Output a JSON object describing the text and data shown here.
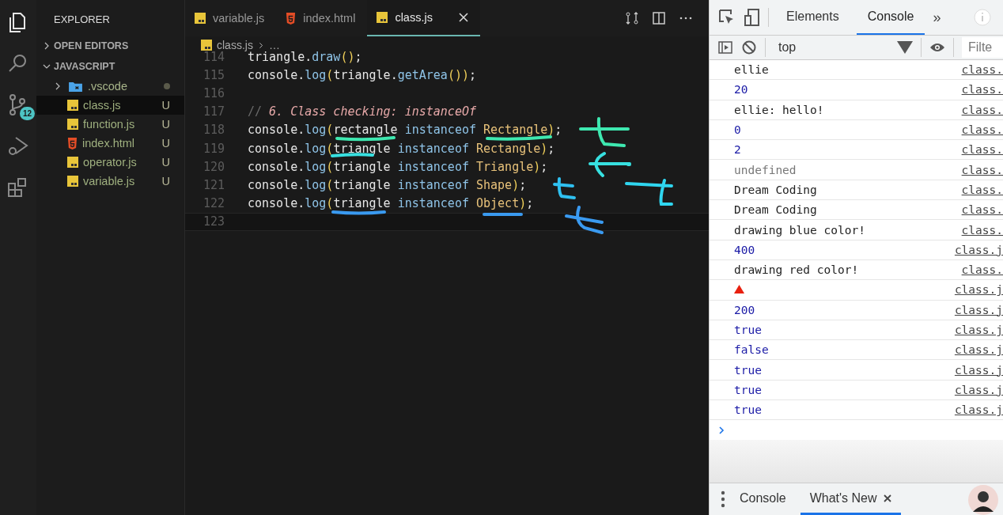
{
  "activity_bar": {
    "items": [
      {
        "kind": "files",
        "selected": true
      },
      {
        "kind": "search",
        "selected": false
      },
      {
        "kind": "source-control",
        "selected": false,
        "badge": "12"
      },
      {
        "kind": "run",
        "selected": false
      },
      {
        "kind": "extensions",
        "selected": false
      }
    ]
  },
  "sidebar": {
    "title": "EXPLORER",
    "sections": [
      {
        "label": "OPEN EDITORS",
        "expanded": false
      },
      {
        "label": "JAVASCRIPT",
        "expanded": true,
        "children": [
          {
            "name": ".vscode",
            "kind": "folder",
            "expanded": false,
            "selected": false
          },
          {
            "name": "class.js",
            "kind": "js",
            "status": "U",
            "selected": true
          },
          {
            "name": "function.js",
            "kind": "js",
            "status": "U",
            "selected": false
          },
          {
            "name": "index.html",
            "kind": "html",
            "status": "U",
            "selected": false
          },
          {
            "name": "operator.js",
            "kind": "js",
            "status": "U",
            "selected": false
          },
          {
            "name": "variable.js",
            "kind": "js",
            "status": "U",
            "selected": false
          }
        ]
      }
    ]
  },
  "editor": {
    "tabs": [
      {
        "label": "variable.js",
        "kind": "js",
        "selected": false
      },
      {
        "label": "index.html",
        "kind": "html",
        "selected": false
      },
      {
        "label": "class.js",
        "kind": "js",
        "selected": true
      }
    ],
    "breadcrumb": {
      "file": "class.js",
      "more": "…"
    },
    "lines": [
      {
        "number": "114",
        "current": false,
        "tokens": [
          {
            "kind": "plain",
            "text": "triangle"
          },
          {
            "kind": "punct",
            "text": "."
          },
          {
            "kind": "method",
            "text": "draw"
          },
          {
            "kind": "paren",
            "text": "()"
          },
          {
            "kind": "plain",
            "text": ";"
          }
        ]
      },
      {
        "number": "115",
        "current": false,
        "tokens": [
          {
            "kind": "plain",
            "text": "console"
          },
          {
            "kind": "punct",
            "text": "."
          },
          {
            "kind": "method",
            "text": "log"
          },
          {
            "kind": "paren",
            "text": "("
          },
          {
            "kind": "plain",
            "text": "triangle"
          },
          {
            "kind": "punct",
            "text": "."
          },
          {
            "kind": "method",
            "text": "getArea"
          },
          {
            "kind": "paren",
            "text": "())"
          },
          {
            "kind": "plain",
            "text": ";"
          }
        ]
      },
      {
        "number": "116",
        "current": false
      },
      {
        "number": "117",
        "current": false,
        "tokens": [
          {
            "kind": "comment-mark",
            "text": "// "
          },
          {
            "kind": "comment",
            "text": "6. Class checking: instanceOf"
          }
        ]
      },
      {
        "number": "118",
        "current": false,
        "tokens": [
          {
            "kind": "plain",
            "text": "console"
          },
          {
            "kind": "punct",
            "text": "."
          },
          {
            "kind": "method",
            "text": "log"
          },
          {
            "kind": "paren",
            "text": "("
          },
          {
            "kind": "plain",
            "text": "rectangle "
          },
          {
            "kind": "keyword",
            "text": "instanceof "
          },
          {
            "kind": "class",
            "text": "Rectangle"
          },
          {
            "kind": "paren",
            "text": ")"
          },
          {
            "kind": "plain",
            "text": ";"
          }
        ]
      },
      {
        "number": "119",
        "current": false,
        "tokens": [
          {
            "kind": "plain",
            "text": "console"
          },
          {
            "kind": "punct",
            "text": "."
          },
          {
            "kind": "method",
            "text": "log"
          },
          {
            "kind": "paren",
            "text": "("
          },
          {
            "kind": "plain",
            "text": "triangle "
          },
          {
            "kind": "keyword",
            "text": "instanceof "
          },
          {
            "kind": "class",
            "text": "Rectangle"
          },
          {
            "kind": "paren",
            "text": ")"
          },
          {
            "kind": "plain",
            "text": ";"
          }
        ]
      },
      {
        "number": "120",
        "current": false,
        "tokens": [
          {
            "kind": "plain",
            "text": "console"
          },
          {
            "kind": "punct",
            "text": "."
          },
          {
            "kind": "method",
            "text": "log"
          },
          {
            "kind": "paren",
            "text": "("
          },
          {
            "kind": "plain",
            "text": "triangle "
          },
          {
            "kind": "keyword",
            "text": "instanceof "
          },
          {
            "kind": "class",
            "text": "Triangle"
          },
          {
            "kind": "paren",
            "text": ")"
          },
          {
            "kind": "plain",
            "text": ";"
          }
        ]
      },
      {
        "number": "121",
        "current": false,
        "tokens": [
          {
            "kind": "plain",
            "text": "console"
          },
          {
            "kind": "punct",
            "text": "."
          },
          {
            "kind": "method",
            "text": "log"
          },
          {
            "kind": "paren",
            "text": "("
          },
          {
            "kind": "plain",
            "text": "triangle "
          },
          {
            "kind": "keyword",
            "text": "instanceof "
          },
          {
            "kind": "class",
            "text": "Shape"
          },
          {
            "kind": "paren",
            "text": ")"
          },
          {
            "kind": "plain",
            "text": ";"
          }
        ]
      },
      {
        "number": "122",
        "current": false,
        "tokens": [
          {
            "kind": "plain",
            "text": "console"
          },
          {
            "kind": "punct",
            "text": "."
          },
          {
            "kind": "method",
            "text": "log"
          },
          {
            "kind": "paren",
            "text": "("
          },
          {
            "kind": "plain",
            "text": "triangle "
          },
          {
            "kind": "keyword",
            "text": "instanceof "
          },
          {
            "kind": "class",
            "text": "Object"
          },
          {
            "kind": "paren",
            "text": ")"
          },
          {
            "kind": "plain",
            "text": ";"
          }
        ]
      },
      {
        "number": "123",
        "current": true
      }
    ]
  },
  "devtools": {
    "tabs": [
      {
        "label": "Elements",
        "selected": false
      },
      {
        "label": "Console",
        "selected": true
      }
    ],
    "more": "»",
    "context": "top",
    "filter": {
      "placeholder": "Filte"
    },
    "messages": [
      {
        "kind": "string",
        "text": "ellie",
        "source": "class."
      },
      {
        "kind": "number",
        "text": "20",
        "source": "class."
      },
      {
        "kind": "string",
        "text": "ellie: hello!",
        "source": "class."
      },
      {
        "kind": "number",
        "text": "0",
        "source": "class."
      },
      {
        "kind": "number",
        "text": "2",
        "source": "class."
      },
      {
        "kind": "undefined",
        "text": "undefined",
        "source": "class."
      },
      {
        "kind": "string",
        "text": "Dream Coding",
        "source": "class."
      },
      {
        "kind": "string",
        "text": "Dream Coding",
        "source": "class."
      },
      {
        "kind": "string",
        "text": "drawing blue color!",
        "source": "class."
      },
      {
        "kind": "number",
        "text": "400",
        "source": "class.j"
      },
      {
        "kind": "string",
        "text": "drawing red color!",
        "source": "class."
      },
      {
        "kind": "triangle",
        "color": "#e8200f",
        "source": "class.j"
      },
      {
        "kind": "number",
        "text": "200",
        "source": "class.j"
      },
      {
        "kind": "number",
        "text": "true",
        "source": "class.j"
      },
      {
        "kind": "number",
        "text": "false",
        "source": "class.j"
      },
      {
        "kind": "number",
        "text": "true",
        "source": "class.j"
      },
      {
        "kind": "number",
        "text": "true",
        "source": "class.j"
      },
      {
        "kind": "number",
        "text": "true",
        "source": "class.j"
      }
    ],
    "drawer_tabs": [
      {
        "label": "Console",
        "selected": false,
        "closable": false
      },
      {
        "label": "What's New",
        "selected": true,
        "closable": true
      }
    ]
  }
}
